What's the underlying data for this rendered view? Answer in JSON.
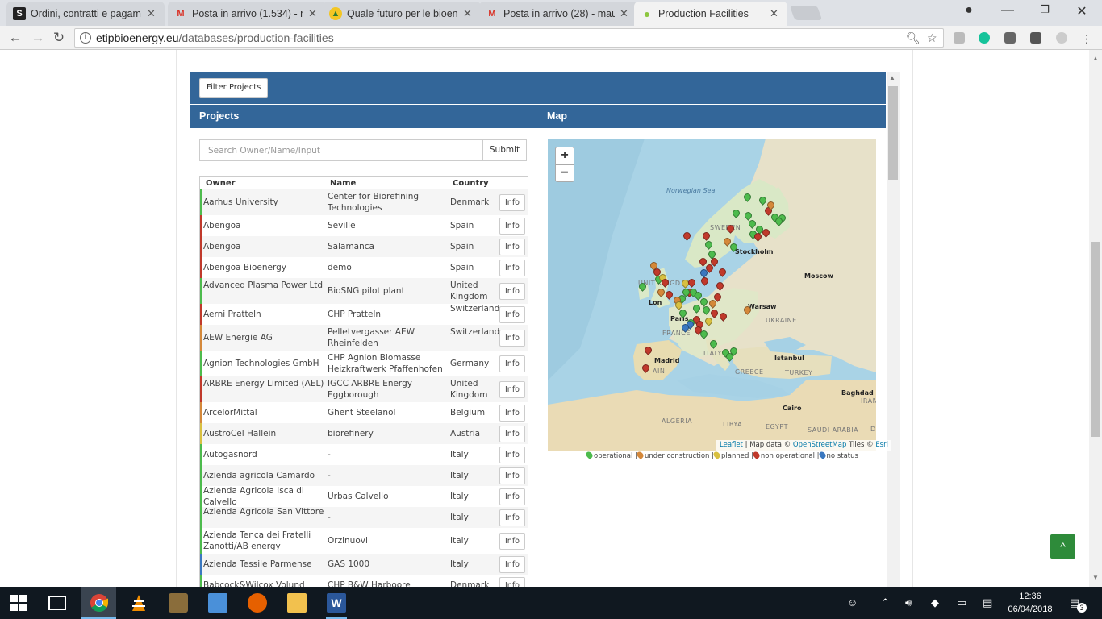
{
  "browser": {
    "tabs": [
      {
        "label": "Ordini, contratti e pagam",
        "favicon": "S"
      },
      {
        "label": "Posta in arrivo (1.534) - n",
        "favicon": "M"
      },
      {
        "label": "Quale futuro per le bioen",
        "favicon": "▲"
      },
      {
        "label": "Posta in arrivo (28) - mau",
        "favicon": "M"
      },
      {
        "label": "Production Facilities",
        "favicon": "●"
      }
    ],
    "url_host": "etipbioenergy.eu",
    "url_path": "/databases/production-facilities"
  },
  "page": {
    "filter_button": "Filter Projects",
    "projects_heading": "Projects",
    "map_heading": "Map",
    "search_placeholder": "Search Owner/Name/Input",
    "submit_label": "Submit",
    "columns": {
      "owner": "Owner",
      "name": "Name",
      "country": "Country"
    },
    "info_label": "Info",
    "rows": [
      {
        "owner": "Aarhus University",
        "name": "Center for Biorefining Technologies",
        "country": "Denmark",
        "status_color": "#4dbb4d"
      },
      {
        "owner": "Abengoa",
        "name": "Seville",
        "country": "Spain",
        "status_color": "#c0392b"
      },
      {
        "owner": "Abengoa",
        "name": "Salamanca",
        "country": "Spain",
        "status_color": "#c0392b"
      },
      {
        "owner": "Abengoa Bioenergy",
        "name": "demo",
        "country": "Spain",
        "status_color": "#c0392b"
      },
      {
        "owner": "Advanced Plasma Power Ltd",
        "name": "BioSNG pilot plant",
        "country": "United Kingdom",
        "status_color": "#4dbb4d"
      },
      {
        "owner": "Aerni Pratteln",
        "name": "CHP Pratteln",
        "country": "Switzerland",
        "status_color": "#c0392b"
      },
      {
        "owner": "AEW Energie AG",
        "name": "Pelletvergasser AEW Rheinfelden",
        "country": "Switzerland",
        "status_color": "#d4883a"
      },
      {
        "owner": "Agnion Technologies GmbH",
        "name": "CHP Agnion Biomasse Heizkraftwerk Pfaffenhofen",
        "country": "Germany",
        "status_color": "#4dbb4d"
      },
      {
        "owner": "ARBRE Energy Limited (AEL)",
        "name": "IGCC ARBRE Energy Eggborough",
        "country": "United Kingdom",
        "status_color": "#c0392b"
      },
      {
        "owner": "ArcelorMittal",
        "name": "Ghent Steelanol",
        "country": "Belgium",
        "status_color": "#d4883a"
      },
      {
        "owner": "AustroCel Hallein",
        "name": "biorefinery",
        "country": "Austria",
        "status_color": "#d8c040"
      },
      {
        "owner": "Autogasnord",
        "name": "-",
        "country": "Italy",
        "status_color": "#4dbb4d"
      },
      {
        "owner": "Azienda agricola Camardo",
        "name": "-",
        "country": "Italy",
        "status_color": "#4dbb4d"
      },
      {
        "owner": "Azienda Agricola Isca di Calvello",
        "name": "Urbas Calvello",
        "country": "Italy",
        "status_color": "#4dbb4d"
      },
      {
        "owner": "Azienda Agricola San Vittore",
        "name": "-",
        "country": "Italy",
        "status_color": "#4dbb4d"
      },
      {
        "owner": "Azienda Tenca dei Fratelli Zanotti/AB energy",
        "name": "Orzinuovi",
        "country": "Italy",
        "status_color": "#4dbb4d"
      },
      {
        "owner": "Azienda Tessile Parmense",
        "name": "GAS 1000",
        "country": "Italy",
        "status_color": "#3a78c0"
      },
      {
        "owner": "Babcock&Wilcox Volund",
        "name": "CHP B&W Harboore",
        "country": "Denmark",
        "status_color": "#4dbb4d"
      }
    ],
    "map": {
      "zoom_in": "+",
      "zoom_out": "−",
      "labels": {
        "norwegian_sea": "Norwegian Sea",
        "sweden": "SWEDEN",
        "stockholm": "Stockholm",
        "moscow": "Moscow",
        "warsaw": "Warsaw",
        "ukraine": "UKRAINE",
        "london": "Lon",
        "paris": "Paris",
        "france": "FRANCE",
        "madrid": "Madrid",
        "spain": "AIN",
        "italy": "ITALY",
        "istanbul": "Istanbul",
        "greece": "GREECE",
        "turkey": "TURKEY",
        "baghdad": "Baghdad",
        "iran": "IRAN",
        "algeria": "ALGERIA",
        "libya": "LIBYA",
        "egypt": "EGYPT",
        "cairo": "Cairo",
        "saudi": "SAUDI ARABIA",
        "uk": "UNIT KINGD",
        "edge": "D"
      },
      "attribution": {
        "leaflet": "Leaflet",
        "mapdata": "| Map data ©",
        "osm": "OpenStreetMap",
        "tiles": "Tiles ©",
        "esri": "Esri"
      },
      "legend": [
        {
          "label": "operational |",
          "color": "#4dbb4d"
        },
        {
          "label": "under construction |",
          "color": "#d4883a"
        },
        {
          "label": "planned |",
          "color": "#d8c040"
        },
        {
          "label": "non operational |",
          "color": "#c0392b"
        },
        {
          "label": "no status",
          "color": "#3a78c0"
        }
      ]
    },
    "back_to_top": "^"
  },
  "taskbar": {
    "time": "12:36",
    "date": "06/04/2018",
    "notifications": "3"
  }
}
